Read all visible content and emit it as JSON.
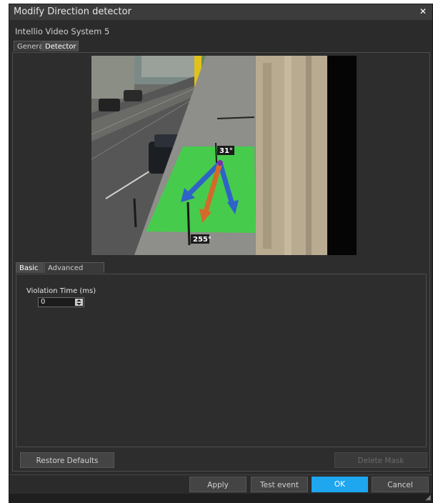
{
  "window": {
    "title": "Modify Direction detector",
    "close_label": "✕"
  },
  "subtitle": "Intellio Video System 5",
  "tabs": [
    {
      "label": "General"
    },
    {
      "label": "Detector"
    }
  ],
  "camera": {
    "angle_top": "31°",
    "angle_bottom": "255°",
    "colors": {
      "zone": "#3fd246",
      "arrow_blue": "#2f63c8",
      "arrow_orange": "#d46a2a"
    }
  },
  "subtabs": [
    {
      "label": "Basic"
    },
    {
      "label": "Advanced Filter"
    }
  ],
  "violation": {
    "label": "Violation Time (ms)",
    "value": "0"
  },
  "buttons": {
    "restore": "Restore Defaults",
    "delete_mask": "Delete Mask",
    "apply": "Apply",
    "test_event": "Test event",
    "ok": "OK",
    "cancel": "Cancel"
  },
  "colors": {
    "accent": "#1ea6ef",
    "background": "#2b2b2b"
  }
}
